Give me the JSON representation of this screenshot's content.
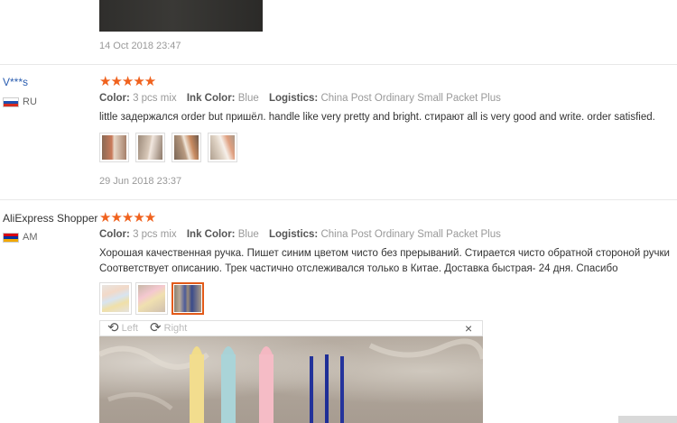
{
  "previous_review": {
    "date": "14 Oct 2018 23:47"
  },
  "reviews": [
    {
      "user": "V***s",
      "country": "RU",
      "stars": "★★★★★",
      "color_label": "Color:",
      "color_value": "3 pcs mix",
      "ink_label": "Ink Color:",
      "ink_value": "Blue",
      "logistics_label": "Logistics:",
      "logistics_value": "China Post Ordinary Small Packet Plus",
      "text": "little задержался order but пришёл. handle like very pretty and bright. стирают all is very good and write. order satisfied.",
      "date": "29 Jun 2018 23:37"
    },
    {
      "user": "AliExpress Shopper",
      "country": "AM",
      "stars": "★★★★★",
      "color_label": "Color:",
      "color_value": "3 pcs mix",
      "ink_label": "Ink Color:",
      "ink_value": "Blue",
      "logistics_label": "Logistics:",
      "logistics_value": "China Post Ordinary Small Packet Plus",
      "text_line1": "Хорошая качественная ручка. Пишет синим цветом чисто без прерываний. Стирается чисто обратной стороной ручки",
      "text_line2": "Соответствует описанию. Трек частично отслеживался только в Китае. Доставка быстрая- 24 дня. Спасибо"
    }
  ],
  "viewer": {
    "left_label": "Left",
    "right_label": "Right",
    "close_label": "×"
  },
  "colors": {
    "star": "#f0621e",
    "username": "#2a5db0",
    "active_thumb": "#e25a19"
  }
}
